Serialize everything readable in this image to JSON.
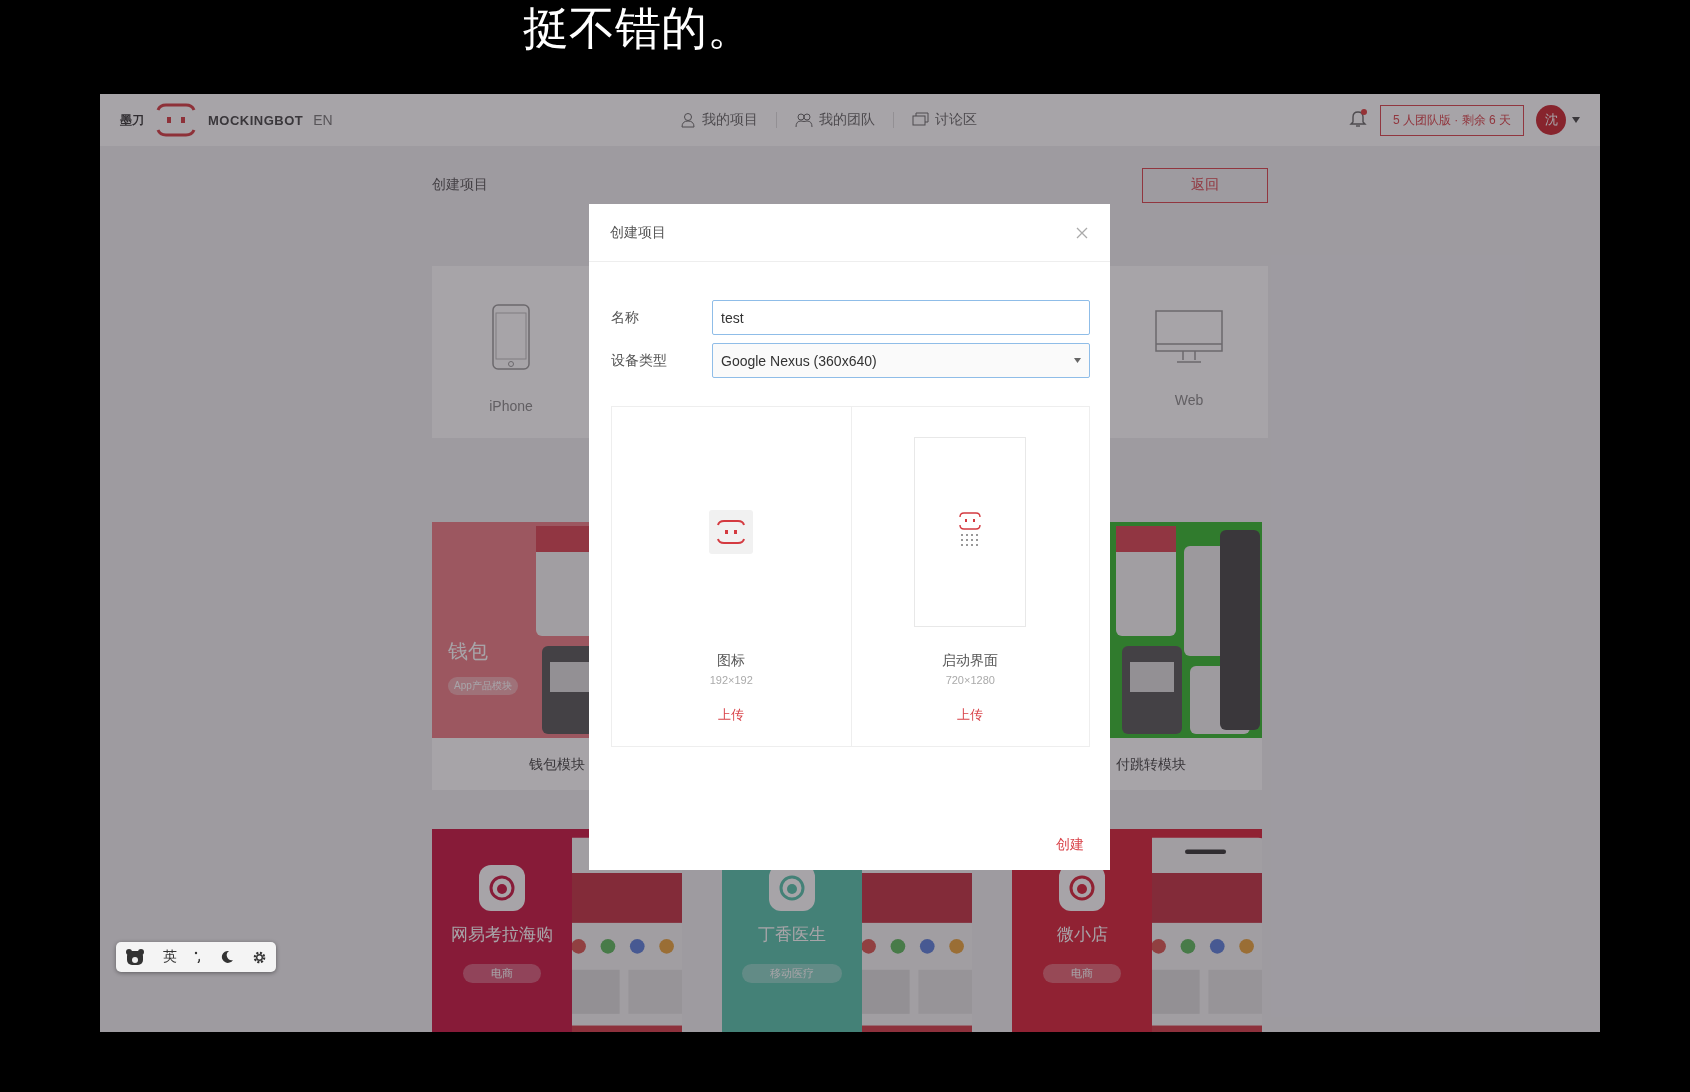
{
  "subtitle": "挺不错的。",
  "header": {
    "logo_text": "墨刀",
    "brand": "MOCKINGBOT",
    "language": "EN",
    "nav": [
      {
        "label": "我的项目",
        "kind": "user"
      },
      {
        "label": "我的团队",
        "kind": "team"
      },
      {
        "label": "讨论区",
        "kind": "chat"
      }
    ],
    "notification": {
      "unread": true
    },
    "plan_badge": "5 人团队版 · 剩余 6 天",
    "avatar": "沈"
  },
  "page": {
    "title": "创建项目",
    "back_button": "返回",
    "device_cards": [
      {
        "label": "iPhone",
        "kind": "phone"
      },
      {
        "label": "Web",
        "kind": "monitor"
      }
    ],
    "template_cards": [
      {
        "caption": "钱包模块",
        "title": "钱包",
        "tag": "App产品模块"
      },
      {
        "caption": "付跳转模块"
      }
    ],
    "showcase_cards": [
      {
        "name": "网易考拉海购",
        "tag": "电商"
      },
      {
        "name": "丁香医生",
        "tag": "移动医疗"
      },
      {
        "name": "微小店",
        "tag": "电商"
      }
    ]
  },
  "dialog": {
    "title": "创建项目",
    "fields": [
      {
        "label": "名称",
        "kind": "text",
        "value": "test"
      },
      {
        "label": "设备类型",
        "kind": "select",
        "value": "Google Nexus (360x640)"
      }
    ],
    "uploads": [
      {
        "kind": "icon",
        "label": "图标",
        "size": "192×192",
        "action": "上传"
      },
      {
        "kind": "splash",
        "label": "启动界面",
        "size": "720×1280",
        "action": "上传"
      }
    ],
    "submit": "创建"
  },
  "ime_toolbar": {
    "mode": "英"
  }
}
